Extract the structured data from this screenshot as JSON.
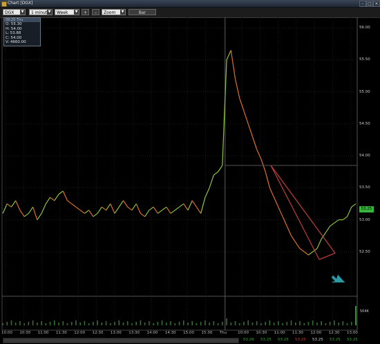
{
  "window": {
    "title": "Chart [DGX]",
    "buttons": [
      "–",
      "□",
      "×"
    ]
  },
  "toolbar": {
    "symbol": "DGX",
    "interval": "1 minute",
    "range": "Week",
    "plus_label": "+",
    "minus_label": "–",
    "zoom_label": "Zoom",
    "bar_label": "Bar"
  },
  "legend": {
    "header": "09:20 Thu",
    "open": "O: 55.30",
    "high": "H: 54.00",
    "low": "L: 53.88",
    "close": "C: 54.00",
    "volume": "V: 4660.00"
  },
  "current_price": "53.25",
  "volume_label": "504K",
  "quotes": [
    {
      "text": "53.26",
      "color": "#2fa82f"
    },
    {
      "text": "53.25",
      "color": "#2fa82f"
    },
    {
      "text": "53.25",
      "color": "#2fa82f"
    },
    {
      "text": "53.25",
      "color": "#d23a2a"
    },
    {
      "text": "53.25",
      "color": "#d0d0d0"
    },
    {
      "text": "53.25",
      "color": "#2fa82f"
    },
    {
      "text": "53.25",
      "color": "#2fa82f"
    }
  ],
  "chart_data": {
    "type": "line",
    "ylim": [
      52.0,
      56.1
    ],
    "yticks": [
      "56.00",
      "55.50",
      "55.00",
      "54.50",
      "54.00",
      "53.50",
      "53.00",
      "52.50"
    ],
    "xticks": [
      "10:00",
      "10:30",
      "11:00",
      "11:30",
      "12:00",
      "12:30",
      "13:00",
      "13:30",
      "14:00",
      "14:30",
      "15:00",
      "15:30",
      "Thu",
      "10:00",
      "10:30",
      "11:00",
      "11:30",
      "12:00",
      "12:30",
      "13:00"
    ],
    "series": [
      {
        "values": [
          53.1,
          53.25,
          53.2,
          53.3,
          53.15,
          53.05,
          53.1,
          53.2,
          53.0,
          53.1,
          53.25,
          53.35,
          53.3,
          53.4,
          53.45,
          53.3,
          53.25,
          53.2,
          53.15,
          53.1,
          53.15,
          53.05,
          53.1,
          53.2,
          53.15,
          53.25,
          53.1,
          53.2,
          53.3,
          53.2,
          53.15,
          53.25,
          53.1,
          53.05,
          53.15,
          53.2,
          53.1,
          53.15,
          53.2,
          53.1,
          53.15,
          53.2,
          53.25,
          53.15,
          53.3,
          53.2,
          53.1,
          53.35,
          53.5,
          53.7,
          53.75,
          53.85,
          55.5,
          55.65,
          55.2,
          54.9,
          54.7,
          54.5,
          54.3,
          54.1,
          53.95,
          53.75,
          53.5,
          53.35,
          53.2,
          53.05,
          52.9,
          52.75,
          52.65,
          52.55,
          52.5,
          52.45,
          52.5,
          52.55,
          52.7,
          52.8,
          52.9,
          52.95,
          53.0,
          53.0,
          53.05,
          53.2,
          53.25
        ]
      }
    ],
    "annotations": {
      "trend_line": [
        53.85,
        52.5
      ],
      "reference_price": 53.85,
      "arrow": "teal"
    }
  }
}
